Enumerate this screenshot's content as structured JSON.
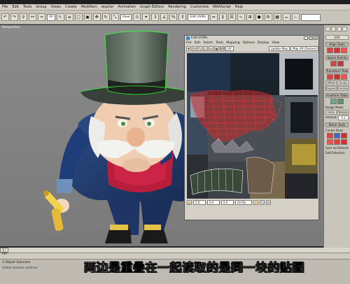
{
  "app": {
    "menu": [
      "File",
      "Edit",
      "Tools",
      "Group",
      "Views",
      "Create",
      "Modifiers",
      "reactor",
      "Animation",
      "Graph Editors",
      "Rendering",
      "Customize",
      "MAXScript",
      "Help"
    ],
    "toolbar": {
      "selection_filter": "All",
      "view_combo": "View",
      "named_selection": "Edit UVWs"
    }
  },
  "viewport": {
    "label": "Perspective"
  },
  "uvw_editor": {
    "title": "Edit UVWs",
    "menu": [
      "File",
      "Edit",
      "Select",
      "Tools",
      "Mapping",
      "Options",
      "Display",
      "View"
    ],
    "update_map_label": "Update Map",
    "texture_combo": "Map #6 (Texture)",
    "channel_combo": "UV",
    "bottom_combo": "All IDs",
    "bottom_value": "0.0"
  },
  "command_panel": {
    "title": "UVS",
    "sections": [
      {
        "head": "Align Tools"
      },
      {
        "head": "Space Evenly"
      },
      {
        "head": "Transform Tools"
      }
    ],
    "offset_label": "Offset",
    "scale_label": "Scale",
    "expand_label": "Expand",
    "contract_label": "Contract",
    "freeform_label": "Freeform Tools",
    "bridge_label": "Budge Mode:",
    "units_label": "Units",
    "rotate_label": "Rotate",
    "amount_label": "Amount:",
    "amount_value": "0.1",
    "stitch_label": "Stitch Tools",
    "center_label": "Center Point",
    "sync_label": "Sync to Element",
    "soft_label": "Soft Selection"
  },
  "timeline": {
    "frame": "0 / 100"
  },
  "status": {
    "line1": "1 Object Selected",
    "line2": "Select texture vertices"
  },
  "subtitle": "两边是重叠在一起读取的是同一块的贴图"
}
